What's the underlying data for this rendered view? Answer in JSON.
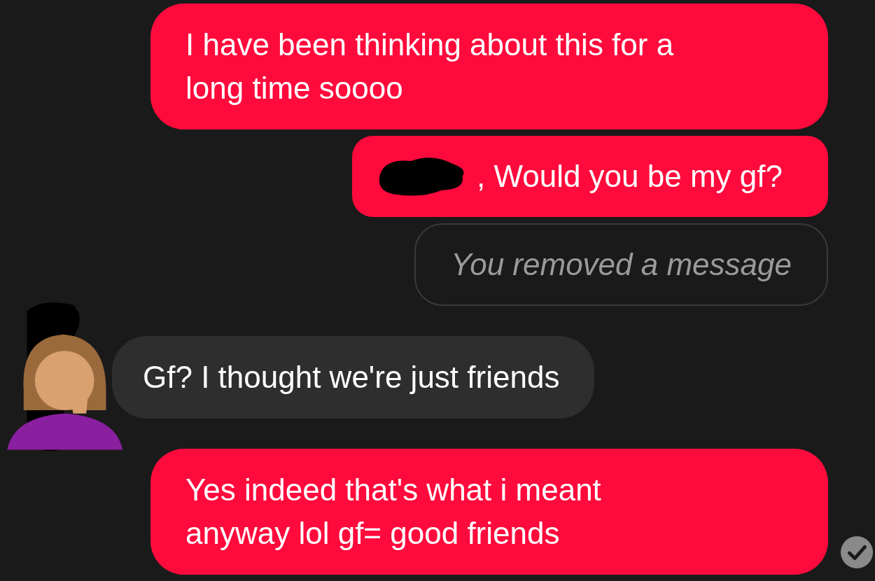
{
  "messages": [
    {
      "kind": "sent",
      "text": "I have been thinking about this for a long time soooo",
      "redacted_prefix": false,
      "read": false
    },
    {
      "kind": "sent",
      "text": ", Would you be my gf?",
      "redacted_prefix": true,
      "read": false
    },
    {
      "kind": "removed",
      "text": "You removed a message"
    },
    {
      "kind": "received",
      "text": "Gf? I thought we're just friends"
    },
    {
      "kind": "sent",
      "text": "Yes indeed that's what i meant anyway lol gf= good friends",
      "redacted_prefix": false,
      "read": true
    }
  ]
}
